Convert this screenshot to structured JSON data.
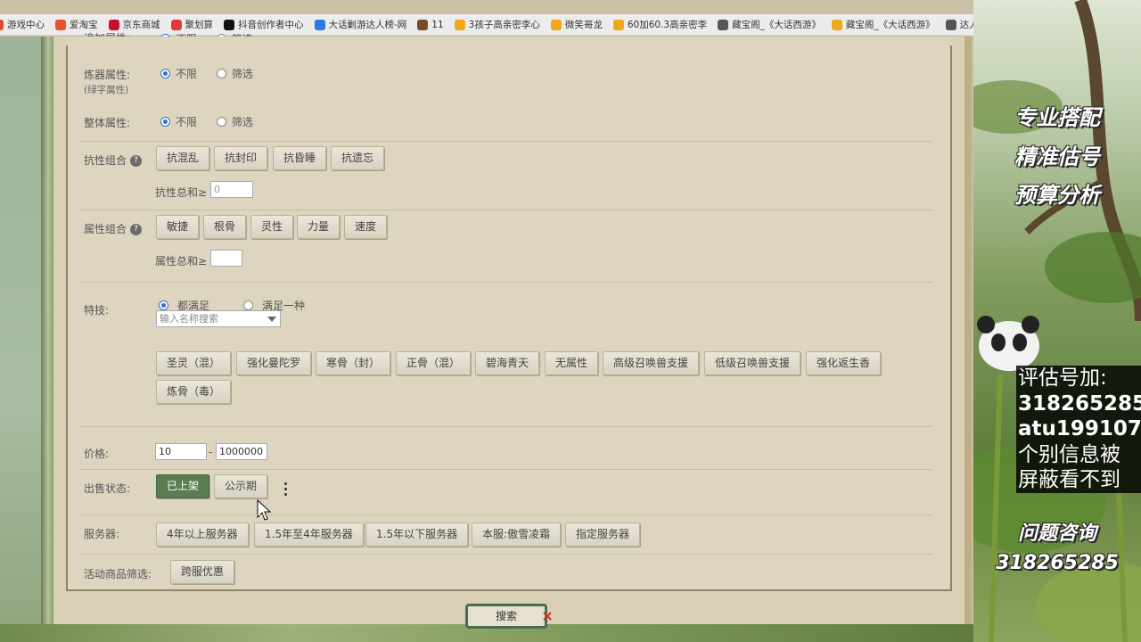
{
  "bookmarks": [
    {
      "label": "游戏中心",
      "color": "#e04b2d"
    },
    {
      "label": "爱淘宝",
      "color": "#e8542a"
    },
    {
      "label": "京东商城",
      "color": "#c8102e"
    },
    {
      "label": "聚划算",
      "color": "#e03a3a"
    },
    {
      "label": "抖音创作者中心",
      "color": "#111111"
    },
    {
      "label": "大话剿游达人榜-网",
      "color": "#2a7ae2"
    },
    {
      "label": "11",
      "color": "#7a4b2a"
    },
    {
      "label": "3孩子高亲密李心",
      "color": "#f0a818"
    },
    {
      "label": "微笑哥龙",
      "color": "#f0a818"
    },
    {
      "label": "60加60.3高亲密李",
      "color": "#f0a818"
    },
    {
      "label": "藏宝阁_《大话西游》",
      "color": "#555555"
    },
    {
      "label": "藏宝阁_《大话西游》",
      "color": "#f0a818"
    },
    {
      "label": "达人后台",
      "color": "#555555"
    }
  ],
  "form": {
    "top_partial_label": "追加属性:",
    "top_partial_opt1": "不限",
    "top_partial_opt2": "筛选",
    "refine_label": "炼器属性:",
    "refine_sublabel": "(绿字属性)",
    "refine_opt1": "不限",
    "refine_opt2": "筛选",
    "overall_label": "整体属性:",
    "overall_opt1": "不限",
    "overall_opt2": "筛选",
    "resist_label": "抗性组合",
    "resist_buttons": [
      "抗混乱",
      "抗封印",
      "抗昏睡",
      "抗遗忘"
    ],
    "resist_sum_label": "抗性总和≥",
    "resist_sum_value": "0",
    "attr_label": "属性组合",
    "attr_buttons": [
      "敏捷",
      "根骨",
      "灵性",
      "力量",
      "速度"
    ],
    "attr_sum_label": "属性总和≥",
    "attr_sum_value": "",
    "skill_label": "特技:",
    "skill_opt1": "都满足",
    "skill_opt2": "满足一种",
    "skill_search_placeholder": "输入名称搜索",
    "skill_buttons_row1": [
      "圣灵（混）",
      "强化曼陀罗",
      "寒骨（封）",
      "正骨（混）",
      "碧海青天",
      "无属性",
      "高级召唤兽支援",
      "低级召唤兽支援",
      "强化返生香"
    ],
    "skill_buttons_row2": [
      "炼骨（毒）"
    ],
    "price_label": "价格:",
    "price_min": "10",
    "price_sep": "-",
    "price_max": "1000000",
    "sale_label": "出售状态:",
    "sale_buttons": [
      "已上架",
      "公示期"
    ],
    "server_label": "服务器:",
    "server_buttons": [
      "4年以上服务器",
      "1.5年至4年服务器",
      "1.5年以下服务器",
      "本服:傲雪凌霜",
      "指定服务器"
    ],
    "promo_filter_label": "活动商品筛选:",
    "promo_filter_button": "跨服优惠",
    "search_button": "搜索",
    "help_glyph": "?"
  },
  "overlay": {
    "promo_lines": [
      "专业搭配",
      "精准估号",
      "预算分析"
    ],
    "contact_lines": [
      "评估号加:",
      "318265285",
      "atu199107",
      "个别信息被",
      "屏蔽看不到"
    ],
    "question_title": "问题咨询",
    "question_number": "318265285"
  }
}
